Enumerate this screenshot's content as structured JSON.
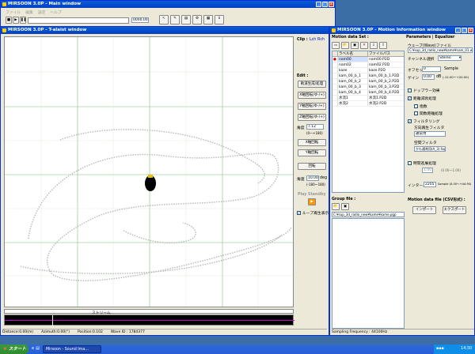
{
  "main_window": {
    "title": "MIRSOON 3.0P - Main window",
    "menu": [
      "ファイル",
      "編集",
      "設定",
      "ヘルプ"
    ],
    "readout": "0000.00",
    "ruler_label": "ストリーム"
  },
  "top_window": {
    "title": "MIRSOON 3.0P - T-alaist window"
  },
  "clip": {
    "title": "Clip :",
    "left": "Lch",
    "right": "Rch"
  },
  "edit": {
    "title": "Edit :",
    "buttons": [
      "軌道生成/処理",
      "X軸回転(ゆ-/+)",
      "Y軸回転(ゆ-/+)",
      "Z軸回転(ゆ-/+)"
    ],
    "amount_label": "角度",
    "amount_value": "7.12",
    "amount_range": "(0〜+180)",
    "rotate_buttons": [
      "X軸回転",
      "Y軸回転"
    ],
    "rotate_single": "回転",
    "angle_label": "角速",
    "angle_value": "10.00",
    "angle_unit": "deg",
    "angle_range": "(-180〜180)"
  },
  "play": {
    "title": "Play Standby",
    "checkbox_label": "ループ再生表示",
    "checked": true
  },
  "status": {
    "distance": "Distance:0.00(m)",
    "azimuth": "Azimuth:0.00(°)",
    "position": "Position:0.102",
    "wave_id": "Wave ID : 1784377"
  },
  "motion_window": {
    "title": "MIRSOON 3.0P - Motion Information window"
  },
  "motion_data_set": {
    "title": "Motion data Set :",
    "columns": [
      "ラベル名",
      "ファイルパス"
    ],
    "rows": [
      {
        "label": "nam00",
        "path": "nam00.P2D",
        "selected": true
      },
      {
        "label": "nam02",
        "path": "nam02.P2D",
        "selected": false
      },
      {
        "label": "kaze",
        "path": "kaze.P2D",
        "selected": false
      },
      {
        "label": "kam_00_b_1",
        "path": "kam_00_b_1.P2D",
        "selected": false
      },
      {
        "label": "kam_00_b_2",
        "path": "kam_00_b_2.P2D",
        "selected": false
      },
      {
        "label": "kam_00_b_3",
        "path": "kam_00_b_3.P2D",
        "selected": false
      },
      {
        "label": "kam_00_b_4",
        "path": "kam_00_b_4.P2D",
        "selected": false
      },
      {
        "label": "水流1",
        "path": "水流1.P2D",
        "selected": false
      },
      {
        "label": "水流2",
        "path": "水流2.P2D",
        "selected": false
      }
    ]
  },
  "group_file": {
    "title": "Group file :",
    "path": "C:¥sup_3d_radio_new¥kame¥kame.pgp"
  },
  "sampling": "Sampling Frequency : 44100Hz",
  "params": {
    "title": "Parameters",
    "eq_label": "Equalizer",
    "wave_file_label": "ウェーブ(Wave)ファイル",
    "wave_file": "C:¥sup_3d_radio_new¥kame¥nam_01.wav",
    "channel_label": "チャンネル選択",
    "channel_value": "Stereo",
    "offset_label": "オフセット",
    "offset_value": "0",
    "offset_unit": "Sample",
    "gain_label": "ゲイン",
    "gain_value": "0.00",
    "gain_unit": "dB",
    "gain_range": "(-12.00〜+20.00)",
    "doppler_label": "ドップラー効果",
    "distance_label": "距離減衰処理",
    "distance_options": [
      "指数",
      "関数距離処理"
    ],
    "filter_label": "フィルタリング",
    "filter_sub": "方向再生フィルタ",
    "filter_value": "通常用",
    "space_filter_label": "空間フィルタ",
    "space_filter_value": "かも通常用(A_3).fap",
    "time_label": "時間進展処理",
    "time_value": "1.00",
    "time_range": "(0.00〜1.00)",
    "interval_label": "インターバル",
    "interval_value": "2205",
    "interval_unit": "Sample (0.00〜+44.90)",
    "motion_file_label": "Motion data file (CSV形式) :",
    "import_button": "インポート",
    "export_button": "エクスポート"
  },
  "taskbar": {
    "start": "スタート",
    "tasks": [
      "Mirsoon - Sound Ima..."
    ],
    "clock": "14:30"
  }
}
